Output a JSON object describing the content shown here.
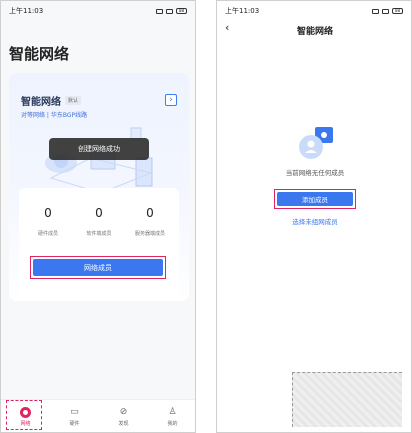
{
  "left_screen": {
    "status": {
      "time": "上午11:03",
      "battery": "88"
    },
    "page_title": "智能网络",
    "card": {
      "title": "智能网络",
      "default_tag": "默认",
      "subtitle": "对等网络 | 华东BGP线路",
      "stats": [
        {
          "value": "0",
          "label": "硬件成员"
        },
        {
          "value": "0",
          "label": "软件端成员"
        },
        {
          "value": "0",
          "label": "服务器端成员"
        }
      ],
      "members_button": "网络成员"
    },
    "toast": "创建网络成功",
    "tabs": [
      {
        "label": "网络",
        "icon": "network-icon",
        "active": true
      },
      {
        "label": "硬件",
        "icon": "router-icon",
        "active": false
      },
      {
        "label": "发现",
        "icon": "compass-icon",
        "active": false
      },
      {
        "label": "我的",
        "icon": "user-icon",
        "active": false
      }
    ],
    "highlight_color": "#e0245e",
    "accent_color": "#3b78f0"
  },
  "right_screen": {
    "status": {
      "time": "上午11:03",
      "battery": "88"
    },
    "title": "智能网络",
    "empty_text": "当前网络无任何成员",
    "add_button": "添加成员",
    "unassigned_link": "选择未组网成员"
  }
}
